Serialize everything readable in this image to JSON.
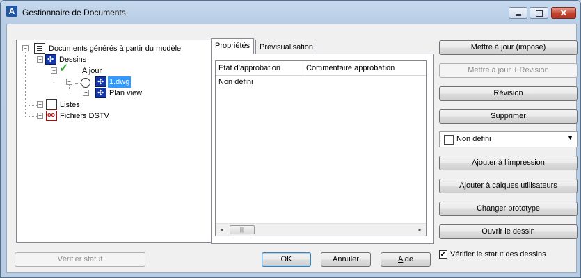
{
  "window": {
    "title": "Gestionnaire de Documents",
    "app_icon": "advance-steel-icon",
    "app_icon_glyph": "A",
    "controls": {
      "minimize": "minimize-icon",
      "maximize": "maximize-icon",
      "close": "close-icon",
      "close_glyph": "✕"
    }
  },
  "tree": {
    "root": {
      "label": "Documents générés à partir du modèle",
      "icon": "documents-icon",
      "expander": "−"
    },
    "drawings": {
      "label": "Dessins",
      "icon": "drawing-icon",
      "expander": "−"
    },
    "up_to_date": {
      "label": "A jour",
      "icon": "check-icon",
      "check_glyph": "✓",
      "expander": "−"
    },
    "file": {
      "label": "1.dwg",
      "icon": "dwg-file-icon",
      "expander": "−",
      "selected": true
    },
    "plan_view": {
      "label": "Plan view",
      "icon": "view-icon",
      "expander": "+"
    },
    "lists": {
      "label": "Listes",
      "icon": "list-icon",
      "expander": "+"
    },
    "dstv": {
      "label": "Fichiers DSTV",
      "icon": "dstv-icon",
      "expander": "+"
    }
  },
  "tabs": [
    {
      "label": "Propriétés",
      "active": true
    },
    {
      "label": "Prévisualisation",
      "active": false
    }
  ],
  "grid": {
    "columns": [
      "Etat d'approbation",
      "Commentaire approbation"
    ],
    "rows": [
      [
        "Non défini",
        ""
      ]
    ],
    "scroll_left": "◂",
    "scroll_right": "▸",
    "thumb_grip": "|||"
  },
  "actions": {
    "update_forced": "Mettre à jour (imposé)",
    "update_revision": "Mettre à jour + Révision",
    "revision": "Révision",
    "delete": "Supprimer",
    "status_select": {
      "value": "Non défini",
      "arrow": "▼"
    },
    "add_print": "Ajouter à l'impression",
    "add_layers": "Ajouter à calques utilisateurs",
    "change_prototype": "Changer prototype",
    "open_drawing": "Ouvrir le dessin",
    "verify_checkbox": {
      "label": "Vérifier le statut des dessins",
      "checked": true,
      "glyph": "✓"
    }
  },
  "footer": {
    "verify_status": "Vérifier statut",
    "ok": "OK",
    "cancel": "Annuler",
    "help_first": "A",
    "help_rest": "ide"
  },
  "colors": {
    "selection": "#3399ff",
    "warning": "#d00000",
    "check": "#2aa52a",
    "dwg_icon": "#1536a8"
  }
}
